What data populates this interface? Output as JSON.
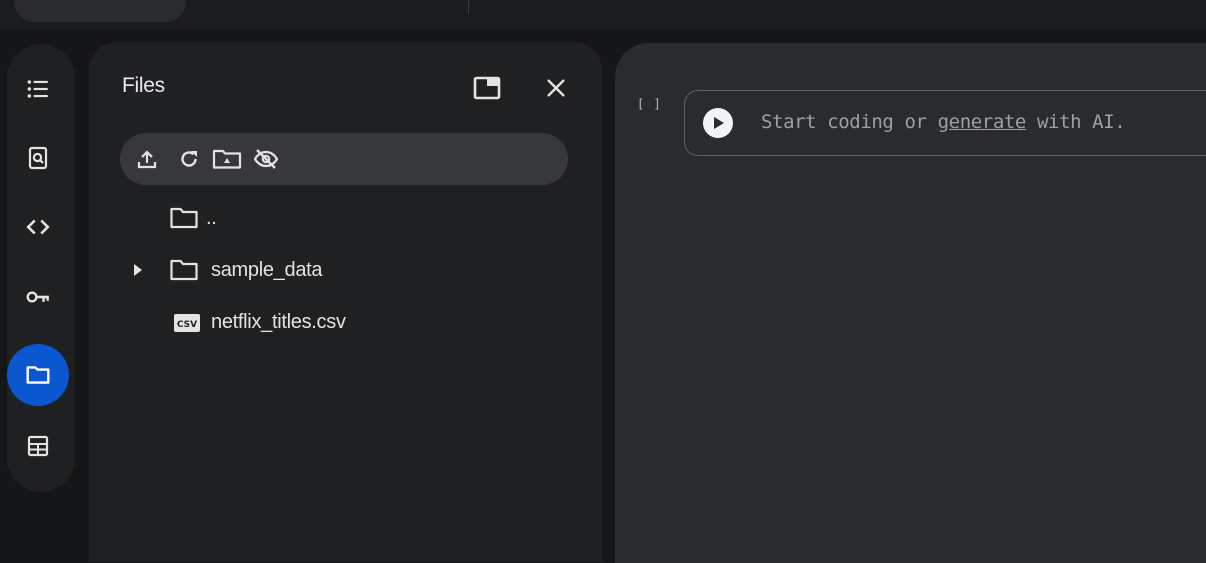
{
  "side_rail": {
    "items": [
      {
        "icon": "table-of-contents-icon",
        "active": false
      },
      {
        "icon": "find-replace-icon",
        "active": false
      },
      {
        "icon": "code-snippets-icon",
        "active": false
      },
      {
        "icon": "secrets-key-icon",
        "active": false
      },
      {
        "icon": "files-folder-icon",
        "active": true
      },
      {
        "icon": "variables-table-icon",
        "active": false
      }
    ],
    "active_color": "#0b57d0"
  },
  "files_panel": {
    "title": "Files",
    "toolbar": [
      "upload-icon",
      "refresh-icon",
      "mount-drive-icon",
      "hide-files-icon"
    ],
    "tree": [
      {
        "label": "..",
        "type": "folder",
        "expandable": false
      },
      {
        "label": "sample_data",
        "type": "folder",
        "expandable": true
      },
      {
        "label": "netflix_titles.csv",
        "type": "csv",
        "expandable": false
      }
    ]
  },
  "editor": {
    "cell_bracket": "[ ]",
    "placeholder_before": "Start coding or ",
    "placeholder_link": "generate",
    "placeholder_after": " with AI."
  }
}
